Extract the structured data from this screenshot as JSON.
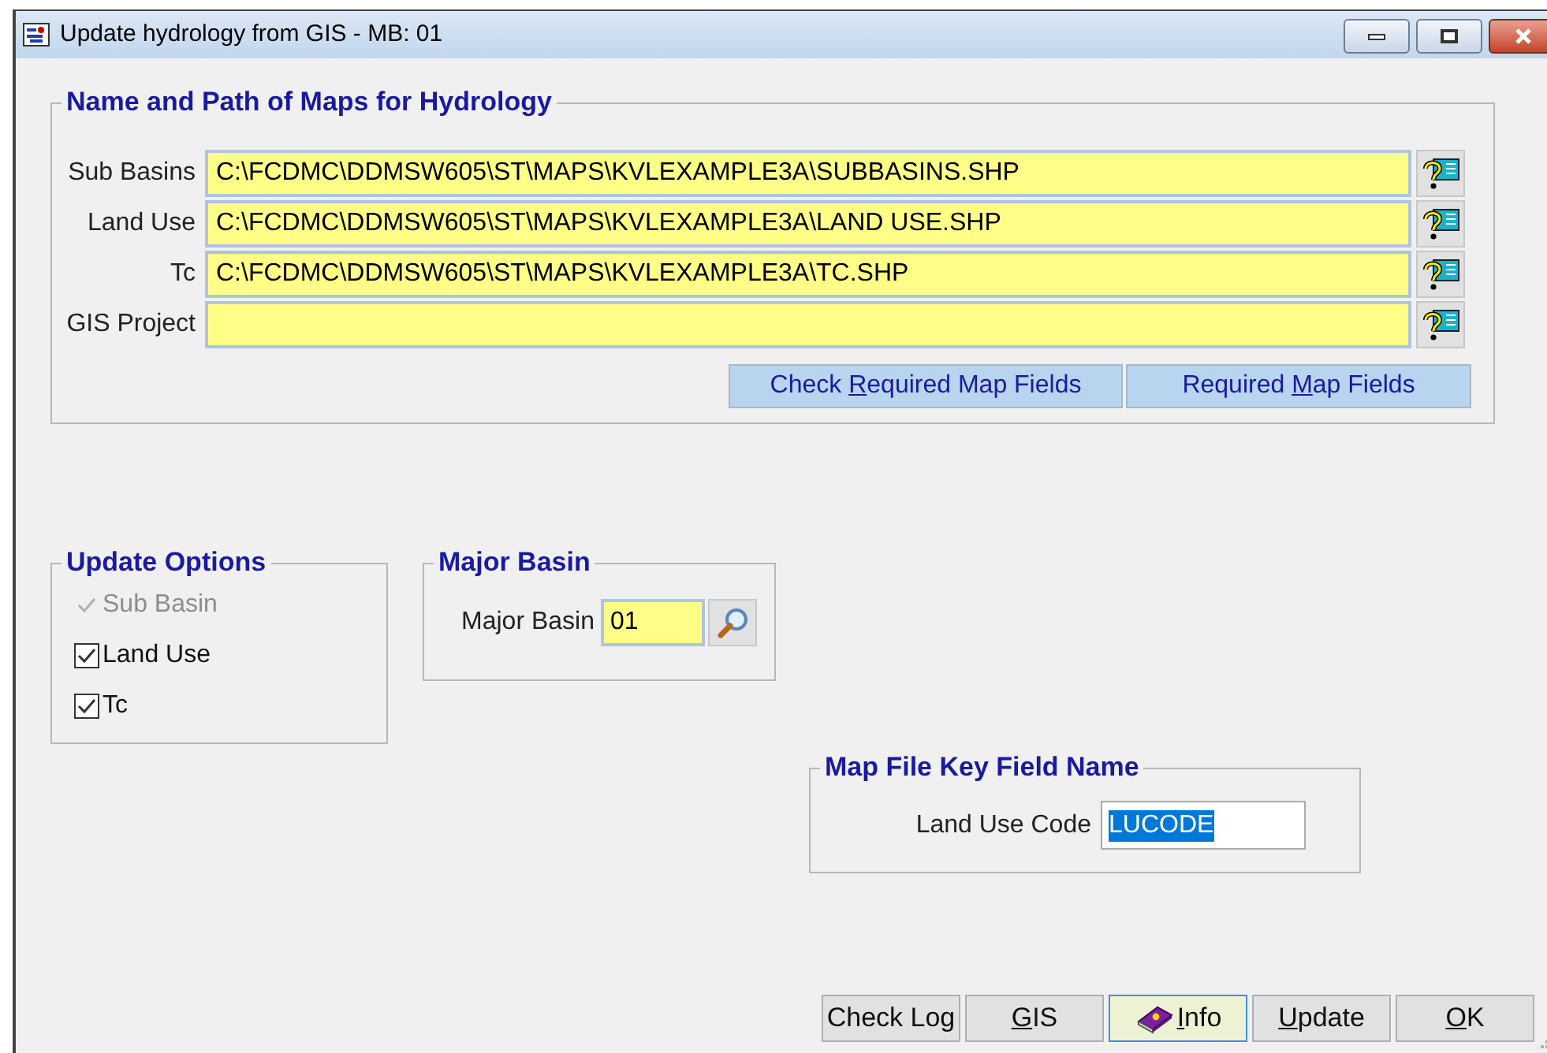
{
  "window": {
    "title": "Update hydrology from GIS - MB: 01"
  },
  "map_paths": {
    "title": "Name and Path of Maps for Hydrology",
    "fields": [
      {
        "label": "Sub Basins",
        "value": "C:\\FCDMC\\DDMSW605\\ST\\MAPS\\KVLEXAMPLE3A\\SUBBASINS.SHP"
      },
      {
        "label": "Land Use",
        "value": "C:\\FCDMC\\DDMSW605\\ST\\MAPS\\KVLEXAMPLE3A\\LAND USE.SHP"
      },
      {
        "label": "Tc",
        "value": "C:\\FCDMC\\DDMSW605\\ST\\MAPS\\KVLEXAMPLE3A\\TC.SHP"
      },
      {
        "label": "GIS Project"
      }
    ],
    "buttons": [
      {
        "label": {
          "before": "Check ",
          "key": "R",
          "after": "equired Map Fields"
        }
      },
      {
        "label": {
          "before": "Required ",
          "key": "M",
          "after": "ap Fields"
        }
      }
    ]
  },
  "update_options": {
    "title": "Update Options",
    "items": [
      {
        "label": "Sub Basin",
        "checked": true,
        "disabled": true
      },
      {
        "label": "Land Use",
        "checked": true,
        "disabled": false
      },
      {
        "label": "Tc",
        "checked": true,
        "disabled": false
      }
    ]
  },
  "major_basin": {
    "title": "Major Basin",
    "label": "Major Basin",
    "value": "01"
  },
  "key_field": {
    "title": "Map File Key Field Name",
    "label": "Land Use Code",
    "value": "LUCODE"
  },
  "bottom_buttons": [
    {
      "kind": "text",
      "label": {
        "before": "Check Log"
      },
      "focused": false
    },
    {
      "kind": "text",
      "label": {
        "key": "G",
        "after": "IS"
      },
      "focused": false
    },
    {
      "kind": "icon_text",
      "label": {
        "key": "I",
        "after": "nfo"
      },
      "focused": true
    },
    {
      "kind": "text",
      "label": {
        "key": "U",
        "after": "pdate"
      },
      "focused": false
    },
    {
      "kind": "text",
      "label": {
        "key": "O",
        "after": "K"
      },
      "focused": false
    }
  ]
}
